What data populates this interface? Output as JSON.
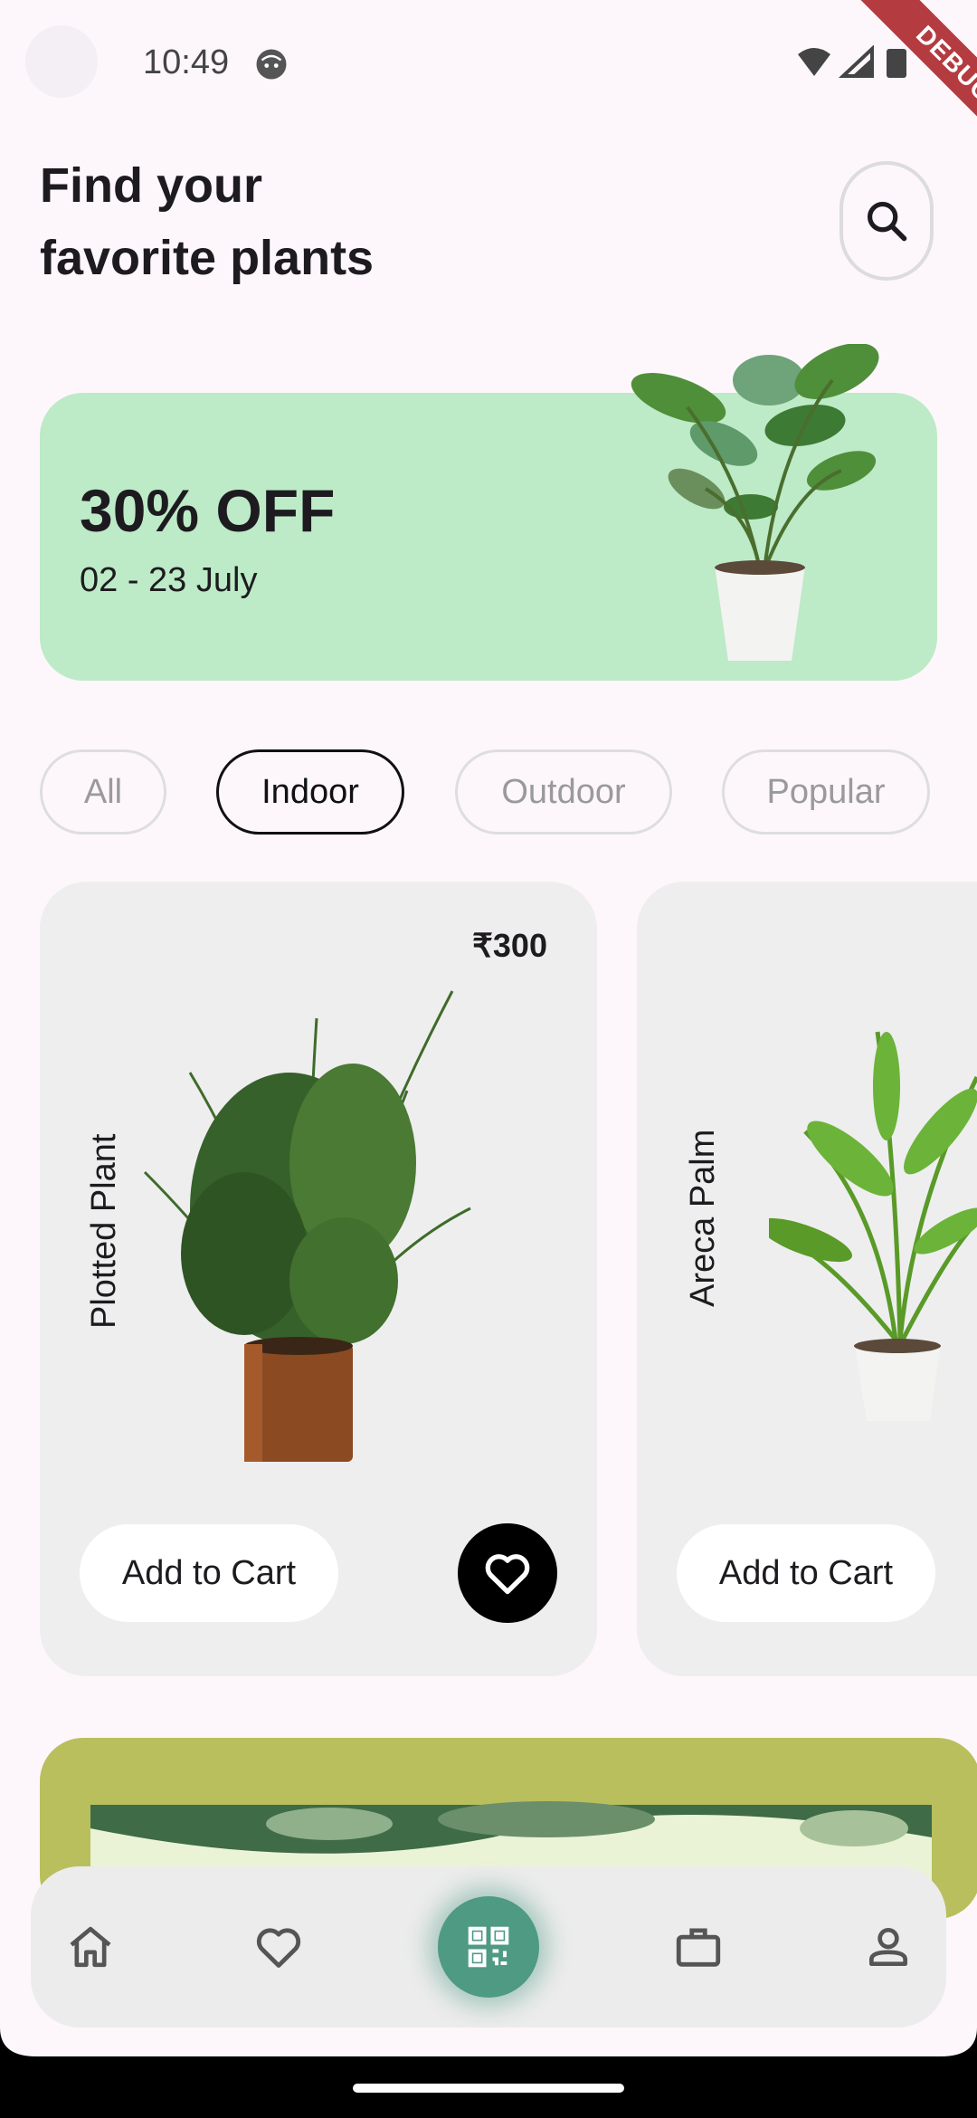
{
  "status_bar": {
    "time": "10:49",
    "debug_label": "DEBUG"
  },
  "header": {
    "title_line1": "Find your",
    "title_line2": "favorite plants",
    "search_icon": "search-icon"
  },
  "promo": {
    "discount": "30% OFF",
    "dates": "02 - 23 July"
  },
  "categories": [
    {
      "label": "All",
      "active": false
    },
    {
      "label": "Indoor",
      "active": true
    },
    {
      "label": "Outdoor",
      "active": false
    },
    {
      "label": "Popular",
      "active": false
    }
  ],
  "products": [
    {
      "name": "Plotted Plant",
      "price": "₹300",
      "cart_label": "Add to Cart",
      "favorite_icon": "heart-icon"
    },
    {
      "name": "Areca Palm",
      "cart_label": "Add to Cart"
    }
  ],
  "bottom_nav": {
    "items": [
      {
        "icon": "home-icon"
      },
      {
        "icon": "heart-outline-icon"
      },
      {
        "icon": "qr-scan-icon"
      },
      {
        "icon": "briefcase-icon"
      },
      {
        "icon": "profile-icon"
      }
    ]
  },
  "colors": {
    "background": "#fdf7fb",
    "promo_bg": "#bdeac7",
    "card_bg": "#eeeeee",
    "accent_green": "#4e9a82",
    "banner2_bg": "#b9bf5d"
  }
}
